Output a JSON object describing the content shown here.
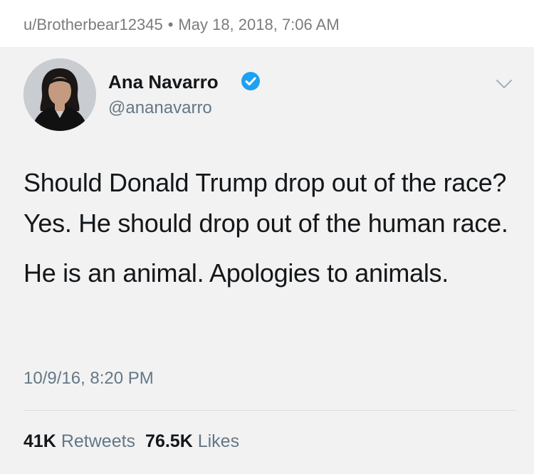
{
  "reddit": {
    "username": "u/Brotherbear12345",
    "separator": "•",
    "date": "May 18, 2018, 7:06 AM"
  },
  "tweet": {
    "author_name": "Ana Navarro",
    "handle": "@ananavarro",
    "verified": true,
    "text_paragraphs": [
      "Should Donald Trump drop out of the race? Yes. He should drop out of the human race.",
      "He is an animal. Apologies to animals."
    ],
    "timestamp": "10/9/16, 8:20 PM",
    "retweets_count": "41K",
    "retweets_label": "Retweets",
    "likes_count": "76.5K",
    "likes_label": "Likes"
  },
  "icons": {
    "verified": "verified-badge-icon",
    "menu": "chevron-down-icon"
  },
  "colors": {
    "verified_blue": "#1da1f2",
    "tweet_background": "#f2f2f2",
    "secondary_text": "#657786",
    "primary_text": "#14171a"
  }
}
